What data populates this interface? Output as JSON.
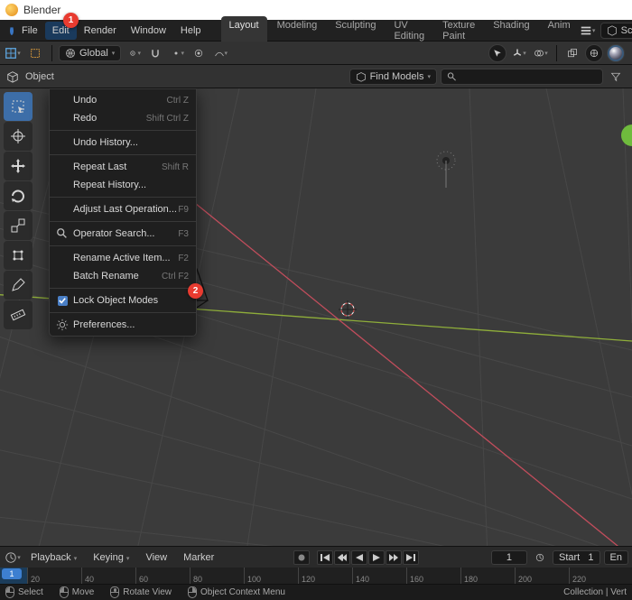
{
  "titlebar": {
    "title": "Blender"
  },
  "colors": {
    "accent": "#3d7fd0",
    "badge": "#e83b30"
  },
  "badges": {
    "edit": "1",
    "prefs": "2"
  },
  "menubar": {
    "items": [
      "File",
      "Edit",
      "Render",
      "Window",
      "Help"
    ],
    "open_index": 1
  },
  "tabs": {
    "items": [
      "Layout",
      "Modeling",
      "Sculpting",
      "UV Editing",
      "Texture Paint",
      "Shading",
      "Anim"
    ],
    "active_index": 0
  },
  "scene_field": {
    "label": "Scene"
  },
  "header2": {
    "mode_label": "Object",
    "orientation": "Global",
    "find": {
      "label": "Find Models",
      "placeholder": ""
    }
  },
  "toolbar": {
    "items": [
      {
        "name": "select-box",
        "active": true
      },
      {
        "name": "cursor"
      },
      {
        "name": "move"
      },
      {
        "name": "rotate"
      },
      {
        "name": "scale"
      },
      {
        "name": "transform"
      },
      {
        "name": "annotate"
      },
      {
        "name": "measure"
      }
    ]
  },
  "dropdown": {
    "groups": [
      [
        {
          "label": "Undo",
          "shortcut": "Ctrl Z"
        },
        {
          "label": "Redo",
          "shortcut": "Shift Ctrl Z"
        }
      ],
      [
        {
          "label": "Undo History...",
          "shortcut": ""
        }
      ],
      [
        {
          "label": "Repeat Last",
          "shortcut": "Shift R"
        },
        {
          "label": "Repeat History...",
          "shortcut": ""
        }
      ],
      [
        {
          "label": "Adjust Last Operation...",
          "shortcut": "F9"
        }
      ],
      [
        {
          "icon": "search",
          "label": "Operator Search...",
          "shortcut": "F3"
        }
      ],
      [
        {
          "label": "Rename Active Item...",
          "shortcut": "F2"
        },
        {
          "label": "Batch Rename",
          "shortcut": "Ctrl F2"
        }
      ],
      [
        {
          "icon": "check",
          "label": "Lock Object Modes",
          "shortcut": ""
        }
      ],
      [
        {
          "icon": "gear",
          "label": "Preferences...",
          "shortcut": ""
        }
      ]
    ]
  },
  "timeline": {
    "menus": [
      "Playback",
      "Keying",
      "View",
      "Marker"
    ],
    "current_frame": "1",
    "start_label": "Start",
    "start_value": "1",
    "end_label": "En",
    "ticks": [
      20,
      40,
      60,
      80,
      100,
      120,
      140,
      160,
      180,
      200,
      220
    ]
  },
  "statusbar": {
    "items": [
      {
        "mouse": "left",
        "label": "Select"
      },
      {
        "mouse": "left",
        "label": "Move"
      },
      {
        "mouse": "middle",
        "label": "Rotate View"
      },
      {
        "mouse": "right",
        "label": "Object Context Menu"
      }
    ],
    "right": "Collection | Vert"
  }
}
